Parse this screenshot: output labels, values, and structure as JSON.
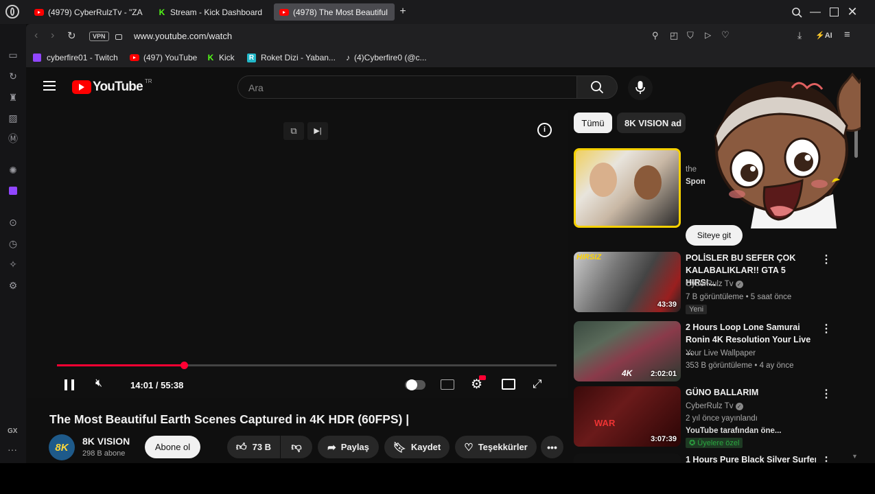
{
  "tabs": [
    {
      "label": "(4979) CyberRulzTv - \"ZA",
      "icon": "youtube-icon"
    },
    {
      "label": "Stream - Kick Dashboard",
      "icon": "kick-icon"
    },
    {
      "label": "(4978) The Most Beautiful",
      "icon": "youtube-icon"
    }
  ],
  "address": {
    "vpn": "VPN",
    "url": "www.youtube.com/watch",
    "ai": "AI"
  },
  "bookmarks": [
    {
      "label": "cyberfire01 - Twitch"
    },
    {
      "label": "(497) YouTube"
    },
    {
      "label": "Kick"
    },
    {
      "label": "Roket Dizi - Yaban..."
    },
    {
      "label": "(4)Cyberfire0 (@c..."
    }
  ],
  "sidebar_bottom": "GX",
  "youtube": {
    "logo": "YouTube",
    "region": "TR",
    "search_placeholder": "Ara",
    "chips": [
      "Tümü",
      "8K VISION ad"
    ],
    "player": {
      "time": "14:01 / 55:38",
      "progress": 0.254
    },
    "video_title": "The Most Beautiful Earth Scenes Captured in 4K HDR (60FPS) |",
    "channel": {
      "avatar_text": "8K",
      "name": "8K VISION",
      "subs": "298 B abone",
      "subscribe": "Abone ol"
    },
    "actions": {
      "likes": "73 B",
      "share": "Paylaş",
      "save": "Kaydet",
      "thanks": "Teşekkürler"
    },
    "sponsored": {
      "line1": "the",
      "line2": "Spon",
      "cta": "Siteye git"
    },
    "related": [
      {
        "title": "POLİSLER BU SEFER ÇOK KALABALIKLAR!! GTA 5 HIRSI...",
        "channel": "CyberRulz Tv",
        "meta": "7 B görüntüleme • 5 saat önce",
        "badge": "Yeni",
        "duration": "43:39",
        "verified": true
      },
      {
        "title": "2 Hours Loop Lone Samurai Ronin 4K Resolution Your Live ...",
        "channel": "Your Live Wallpaper",
        "meta": "353 B görüntüleme • 4 ay önce",
        "badge": "",
        "duration": "2:02:01",
        "verified": false
      },
      {
        "title": "GÜNO BALLARIM",
        "channel": "CyberRulz Tv",
        "meta": "2 yıl önce yayınlandı",
        "extra": "YouTube tarafından öne...",
        "badge": "Üyelere özel",
        "duration": "3:07:39",
        "verified": true
      },
      {
        "title": "1 Hours Pure Black Silver Surfer",
        "channel": "",
        "meta": "",
        "badge": "",
        "duration": "",
        "verified": false
      }
    ]
  },
  "colors": {
    "accent": "#ff0033",
    "kick": "#53fc18",
    "twitch": "#9146ff",
    "member_badge": "#2ba640"
  }
}
